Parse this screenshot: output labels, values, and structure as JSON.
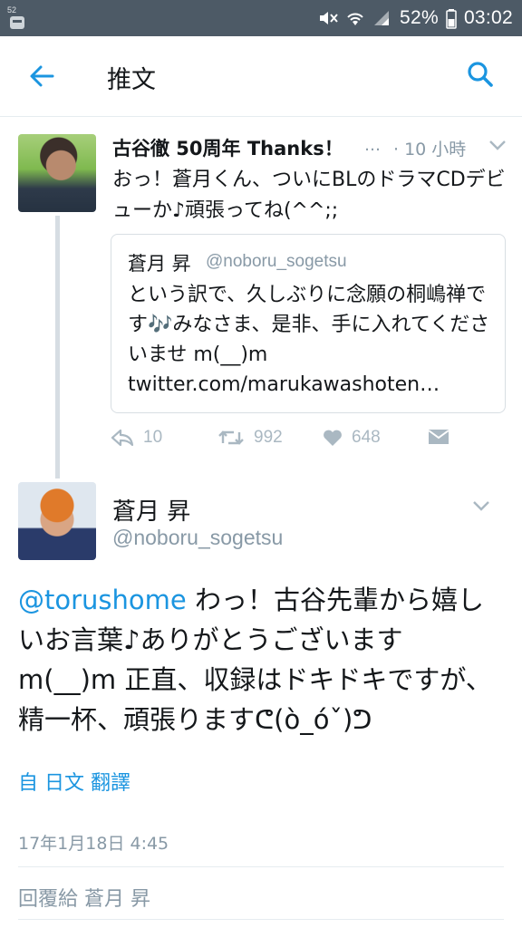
{
  "status_bar": {
    "badge": "52",
    "battery": "52%",
    "time": "03:02"
  },
  "app_bar": {
    "title": "推文"
  },
  "tweet1": {
    "name": "古谷徹 50周年 Thanks！",
    "ellipsis": "…",
    "time": "· 10 小時",
    "text": "おっ！蒼月くん、ついにBLのドラマCDデビューか♪頑張ってね(^^;;",
    "quote": {
      "name": "蒼月 昇",
      "handle": "@noboru_sogetsu",
      "text_part1": "という訳で、久しぶりに念願の桐嶋禅です",
      "note": "🎶",
      "text_part2": "みなさま、是非、手に入れてくださいませ m(__)m",
      "link": "twitter.com/marukawashoten…"
    },
    "actions": {
      "reply": "10",
      "retweet": "992",
      "like": "648"
    }
  },
  "tweet2": {
    "name": "蒼月 昇",
    "handle": "@noboru_sogetsu",
    "mention": "@torushome",
    "text": " わっ！古谷先輩から嬉しいお言葉♪ありがとうございます m(__)m 正直、収録はドキドキですが、精一杯、頑張りますᕦ(ò_óˇ)ᕤ",
    "translate": "自 日文 翻譯",
    "timestamp": "17年1月18日 4:45"
  },
  "reply_bar": {
    "placeholder": "回覆給 蒼月 昇"
  },
  "colors": {
    "accent": "#1b95e0",
    "muted": "#8899a6",
    "statusbar": "#4d5a66"
  }
}
